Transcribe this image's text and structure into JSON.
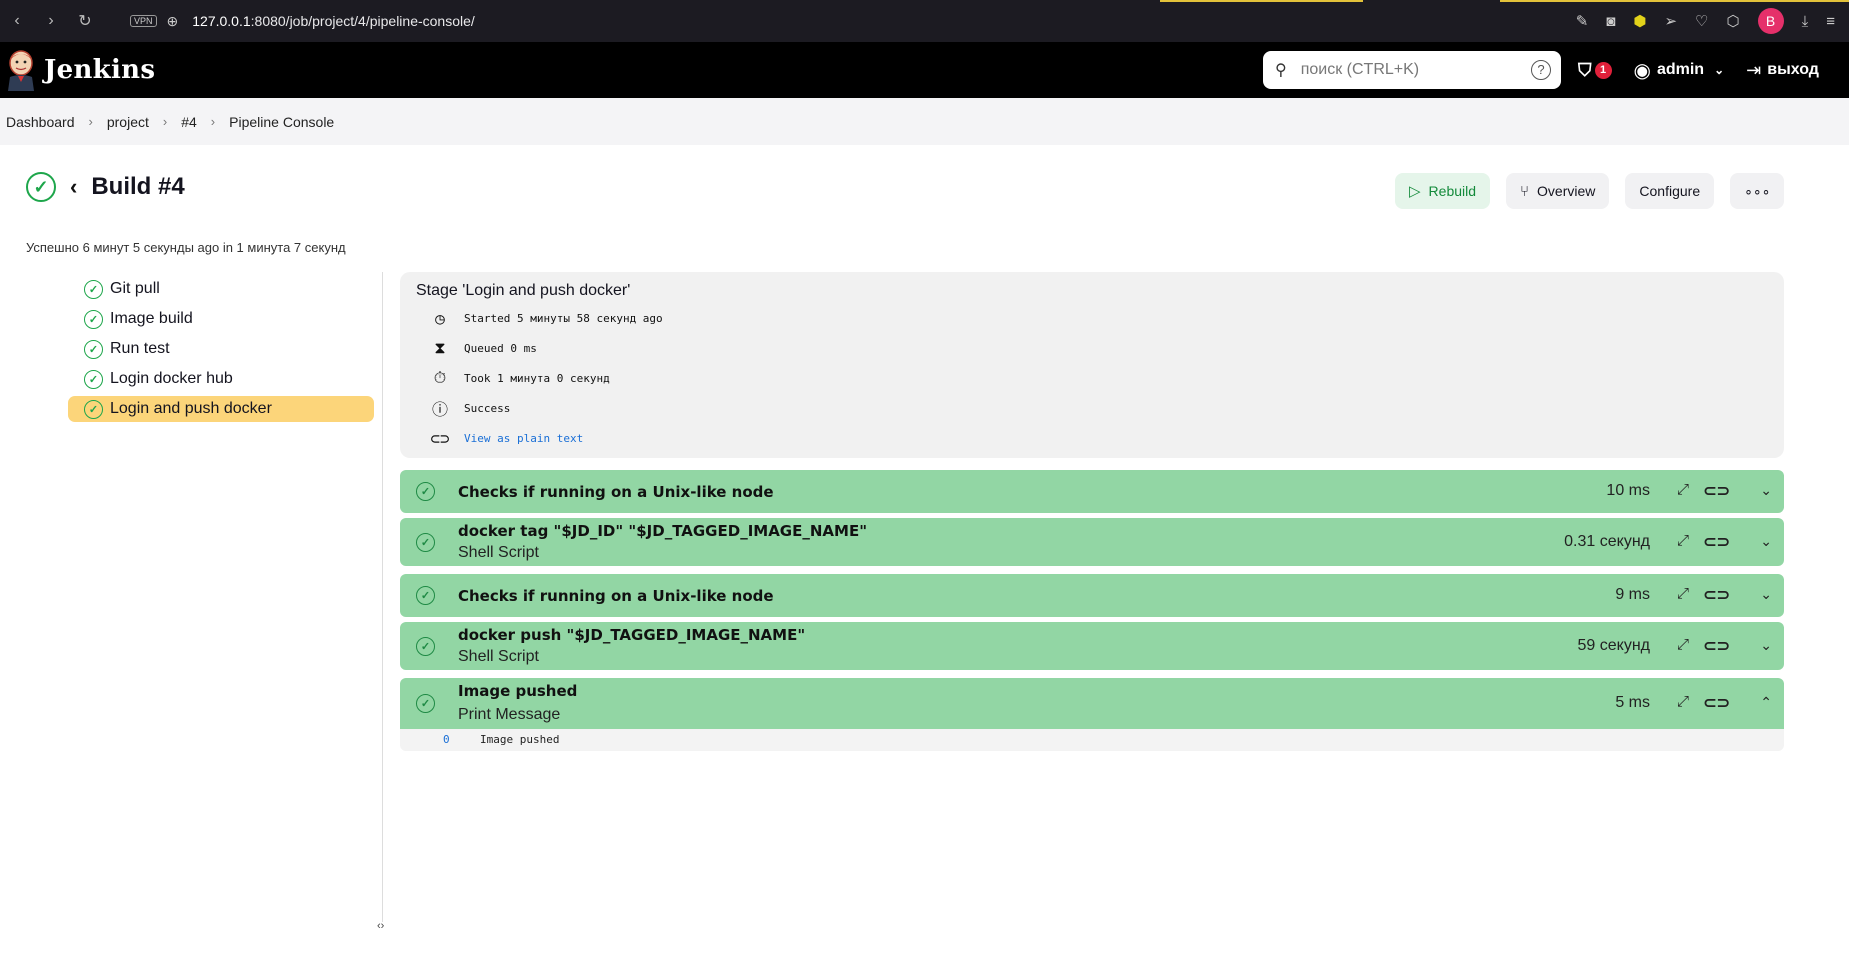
{
  "browser": {
    "url_host": "127.0.0.1",
    "url_rest": ":8080/job/project/4/pipeline-console/",
    "vpn_label": "VPN",
    "profile_initial": "B"
  },
  "header": {
    "brand": "Jenkins",
    "search_placeholder": "поиск (CTRL+K)",
    "help_glyph": "?",
    "security_badge_count": "1",
    "user": "admin",
    "logout_label": "выход"
  },
  "breadcrumbs": [
    "Dashboard",
    "project",
    "#4",
    "Pipeline Console"
  ],
  "build": {
    "title": "Build #4",
    "subtitle": "Успешно 6 минут 5 секунды ago in 1 минута 7 секунд",
    "actions": {
      "rebuild": "Rebuild",
      "overview": "Overview",
      "configure": "Configure",
      "more": "∘∘∘"
    }
  },
  "stages": [
    {
      "label": "Git pull"
    },
    {
      "label": "Image build"
    },
    {
      "label": "Run test"
    },
    {
      "label": "Login docker hub"
    },
    {
      "label": "Login and push docker"
    }
  ],
  "stage_detail": {
    "name": "Stage 'Login and push docker'",
    "started": "Started 5 минуты 58 секунд ago",
    "queued": "Queued 0 ms",
    "took": "Took 1 минута 0 секунд",
    "status": "Success",
    "plain_text_link": "View as plain text"
  },
  "steps": [
    {
      "title": "Checks if running on a Unix-like node",
      "subtitle": "",
      "duration": "10 ms",
      "expanded": false
    },
    {
      "title": "docker tag \"$JD_ID\" \"$JD_TAGGED_IMAGE_NAME\"",
      "subtitle": "Shell Script",
      "duration": "0.31 секунд",
      "expanded": false
    },
    {
      "title": "Checks if running on a Unix-like node",
      "subtitle": "",
      "duration": "9 ms",
      "expanded": false
    },
    {
      "title": "docker push \"$JD_TAGGED_IMAGE_NAME\"",
      "subtitle": "Shell Script",
      "duration": "59 секунд",
      "expanded": false
    },
    {
      "title": "Image pushed",
      "subtitle": "Print Message",
      "duration": "5 ms",
      "expanded": true
    }
  ],
  "log": {
    "line_number": "0",
    "line_text": "Image pushed"
  },
  "colors": {
    "success_green": "#1ea64b",
    "step_bg": "#92d6a4",
    "active_stage": "#fcd57a",
    "link_blue": "#1a6fd6"
  }
}
